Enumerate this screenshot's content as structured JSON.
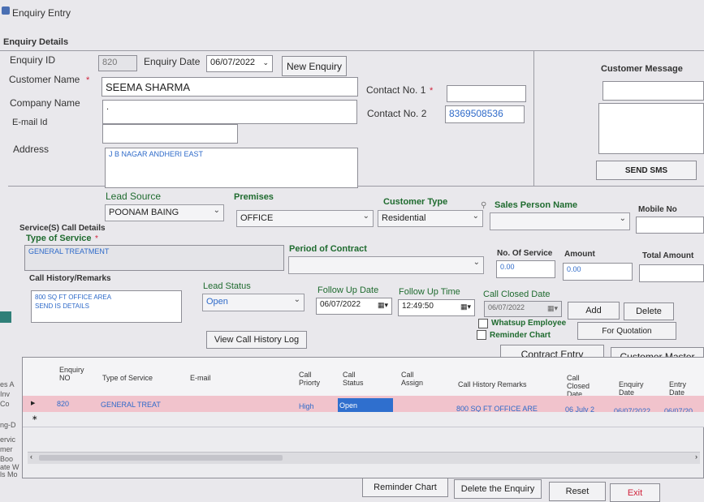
{
  "window": {
    "title": "Enquiry Entry"
  },
  "section_enquiry_details": "Enquiry Details",
  "labels": {
    "enquiry_id": "Enquiry ID",
    "enquiry_date": "Enquiry Date",
    "customer_name": "Customer Name",
    "company_name": "Company Name",
    "email": "E-mail Id",
    "address": "Address",
    "contact1": "Contact No. 1",
    "contact2": "Contact No. 2",
    "customer_message": "Customer Message",
    "lead_source": "Lead Source",
    "premises": "Premises",
    "customer_type": "Customer  Type",
    "sales_person": "Sales Person Name",
    "mobile_no": "Mobile No",
    "service_call_details": "Service(S)  Call Details",
    "type_of_service": "Type of Service",
    "period_of_contract": "Period of Contract",
    "no_of_service": "No. Of Service",
    "amount": "Amount",
    "total_amount": "Total Amount",
    "call_history_remarks": "Call History/Remarks",
    "lead_status": "Lead Status",
    "follow_up_date": "Follow Up Date",
    "follow_up_time": "Follow Up Time",
    "call_closed_date": "Call Closed Date",
    "whatsup_employee": "Whatsup  Employee",
    "reminder_chart_chk": "Reminder  Chart",
    "required_mark": "*"
  },
  "values": {
    "enquiry_id": "820",
    "enquiry_date": "06/07/2022",
    "customer_name": "SEEMA SHARMA",
    "company_name": ".",
    "email": "",
    "address": "J B NAGAR ANDHERI EAST",
    "contact1": "",
    "contact2": "8369508536",
    "lead_source": "POONAM BAING",
    "premises": "OFFICE",
    "customer_type": "Residential",
    "sales_person": "",
    "mobile_no": "",
    "type_of_service": "GENERAL TREATMENT",
    "period_of_contract": "",
    "no_of_service": "0.00",
    "amount": "0.00",
    "total_amount": "",
    "call_history_remarks": "800 SQ FT OFFICE AREA\nSEND IS DETAILS",
    "lead_status": "Open",
    "follow_up_date": "06/07/2022",
    "follow_up_time": "12:49:50",
    "call_closed_date": "06/07/2022"
  },
  "buttons": {
    "new_enquiry": "New Enquiry",
    "send_sms": "SEND SMS",
    "add": "Add",
    "delete": "Delete",
    "for_quotation": "For Quotation",
    "view_call_history_log": "View Call History Log",
    "contract_entry": "Contract Entry",
    "customer_master": "Customer Master",
    "reminder_chart": "Reminder Chart",
    "delete_enquiry": "Delete the Enquiry",
    "reset": "Reset",
    "exit": "Exit"
  },
  "grid": {
    "columns": [
      "Enquiry NO",
      "Type of Service",
      "E-mail",
      "Call Priorty",
      "Call Status",
      "Call Assign",
      "Call History Remarks",
      "Call Closed Date",
      "Enquiry Date",
      "Entry Date"
    ],
    "rows": [
      {
        "enquiry_no": "820",
        "type_of_service": "GENERAL TREAT",
        "email": "",
        "priority": "High",
        "status": "Open",
        "assign": "",
        "remarks": "800 SQ FT OFFICE ARE",
        "closed": "06 July 2",
        "enquiry_date": "06/07/2022",
        "entry_date": "06/07/20"
      }
    ]
  },
  "left_edge_fragments": [
    "es A",
    "Inv",
    "Co",
    "ng-D",
    "ervic",
    "mer",
    "Boo",
    "ate W",
    "ls Mo"
  ],
  "colors": {
    "selected_row": "#f1c3cc",
    "status_cell": "#2f6fce",
    "label_green": "#1f6b2f",
    "required": "#d0223a"
  }
}
